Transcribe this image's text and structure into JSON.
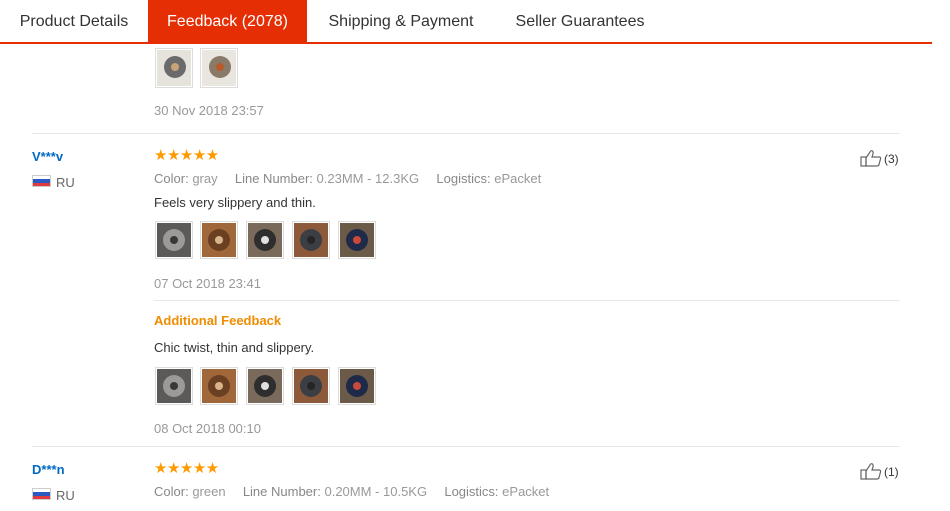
{
  "tabs": [
    {
      "label": "Product Details",
      "active": false
    },
    {
      "label": "Feedback (2078)",
      "active": true
    },
    {
      "label": "Shipping & Payment",
      "active": false
    },
    {
      "label": "Seller Guarantees",
      "active": false
    }
  ],
  "colors": {
    "accent": "#e62e04",
    "star": "#ff9a00",
    "user_link": "#0069c4",
    "additional_feedback": "#f08c00"
  },
  "prev_review": {
    "date": "30 Nov 2018 23:57",
    "thumb_count": 2
  },
  "reviews": [
    {
      "user": "V***v",
      "country": "RU",
      "stars": "★★★★★",
      "attributes": [
        {
          "key": "Color:",
          "value": "gray"
        },
        {
          "key": "Line Number:",
          "value": "0.23MM - 12.3KG"
        },
        {
          "key": "Logistics:",
          "value": "ePacket"
        }
      ],
      "text": "Feels very slippery and thin.",
      "date": "07 Oct 2018 23:41",
      "likes": "(3)",
      "additional": {
        "heading": "Additional Feedback",
        "text": "Chic twist, thin and slippery.",
        "date": "08 Oct 2018 00:10"
      }
    },
    {
      "user": "D***n",
      "country": "RU",
      "stars": "★★★★★",
      "attributes": [
        {
          "key": "Color:",
          "value": "green"
        },
        {
          "key": "Line Number:",
          "value": "0.20MM - 10.5KG"
        },
        {
          "key": "Logistics:",
          "value": "ePacket"
        }
      ],
      "likes": "(1)"
    }
  ]
}
